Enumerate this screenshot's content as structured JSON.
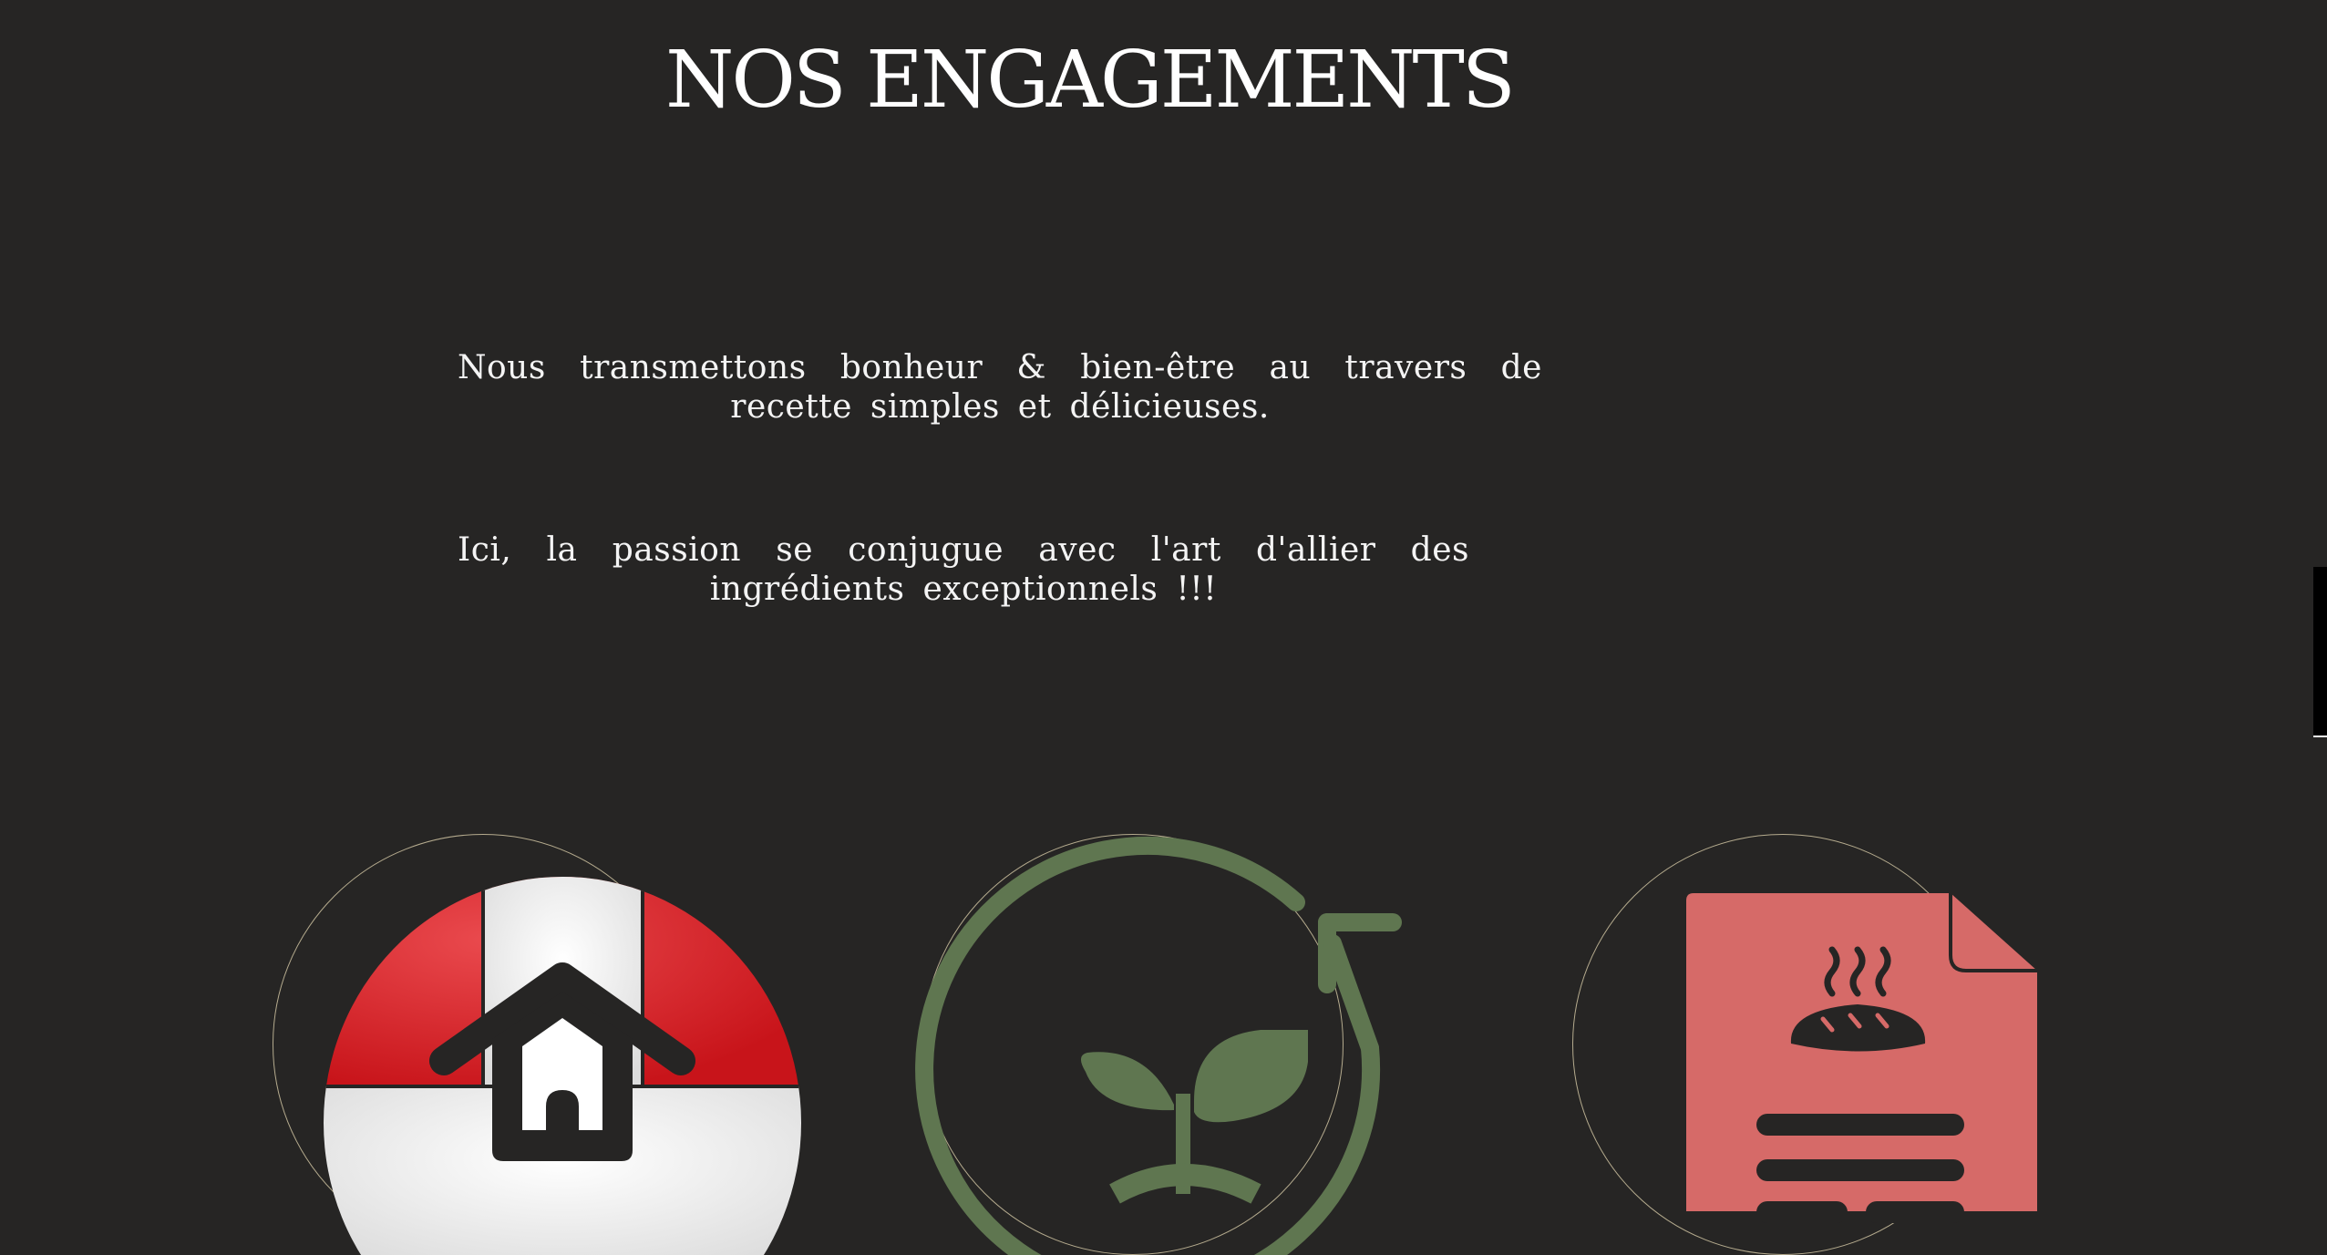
{
  "section": {
    "title": "NOS ENGAGEMENTS",
    "paragraphs": [
      "Nous transmettons bonheur & bien-être au travers de recette simples et délicieuses.",
      "Ici, la passion se conjugue avec l'art d'allier des ingrédients exceptionnels !!!"
    ]
  },
  "icons": [
    "house-ball-icon",
    "eco-plant-icon",
    "bread-recipe-icon"
  ],
  "colors": {
    "background": "#262524",
    "text": "#ffffff",
    "ring": "#b5ab8e",
    "red": "#d01818",
    "green": "#5f7650",
    "recipe_red": "#d66a68",
    "dark": "#262524"
  }
}
